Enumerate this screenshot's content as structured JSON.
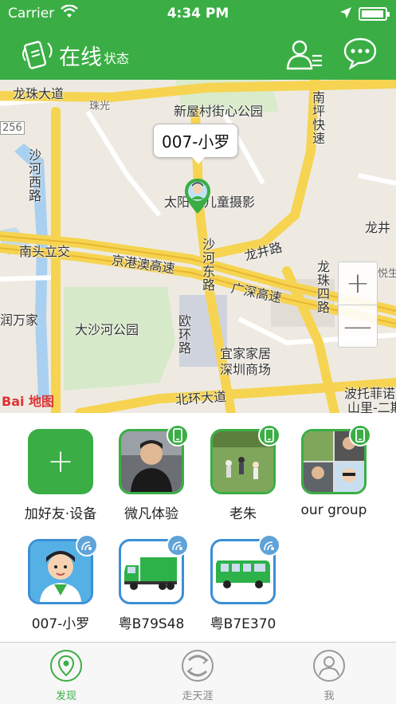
{
  "status": {
    "carrier": "Carrier",
    "time": "4:34 PM"
  },
  "header": {
    "title": "在线",
    "subtitle": "状态",
    "contacts_icon": "contacts-list-icon",
    "chat_icon": "chat-bubble-icon"
  },
  "map": {
    "callout": "007-小罗",
    "labels": {
      "longzhu": "龙珠大道",
      "zhuguang": "珠光",
      "xinwucun": "新屋村街心公园",
      "nanping": "南坪快速",
      "n256": "256",
      "shahexi": "沙河西路",
      "taiyang": "太阳",
      "ertong": "儿童摄影",
      "longjing": "龙井",
      "nantou": "南头立交",
      "jinggang": "京港澳高速",
      "longjinglu": "龙井路",
      "longzhusi": "龙珠四路",
      "shahedong": "沙河东路",
      "guangshen": "广深高速",
      "yue": "悦生",
      "runwanjia": "润万家",
      "dashahe": "大沙河公园",
      "ouhuan": "欧环路",
      "yijia": "宜家家居",
      "yijia2": "深圳商场",
      "beihuan": "北环大道",
      "botuo": "波托菲诺",
      "shanli": "山里-二期",
      "baidu": "Bai 地图"
    },
    "zoom_in": "+",
    "zoom_out": "—"
  },
  "grid": {
    "items": [
      {
        "name": "加好友·设备",
        "kind": "add"
      },
      {
        "name": "微凡体验",
        "kind": "phone"
      },
      {
        "name": "老朱",
        "kind": "phone"
      },
      {
        "name": "our group",
        "kind": "phone"
      },
      {
        "name": "007-小罗",
        "kind": "tracker"
      },
      {
        "name": "粤B79S48",
        "kind": "tracker"
      },
      {
        "name": "粤B7E370",
        "kind": "tracker"
      }
    ],
    "add_symbol": "+"
  },
  "tabs": [
    {
      "label": "发现",
      "icon": "location-pin-icon"
    },
    {
      "label": "走天涯",
      "icon": "route-icon"
    },
    {
      "label": "我",
      "icon": "person-icon"
    }
  ],
  "colors": {
    "brand": "#3aae45",
    "tracker": "#5fa3d8"
  }
}
